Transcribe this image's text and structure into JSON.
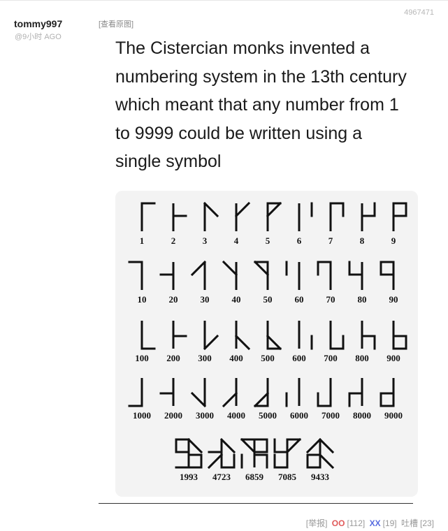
{
  "post": {
    "author": "tommy997",
    "time": "@9小时 AGO",
    "view_original": "[查看原图]",
    "id": "4967471"
  },
  "caption": "The Cistercian monks invented a numbering system in the 13th century which meant that any number from 1 to 9999 could be written using a single symbol",
  "image": {
    "rows": [
      [
        "1",
        "2",
        "3",
        "4",
        "5",
        "6",
        "7",
        "8",
        "9"
      ],
      [
        "10",
        "20",
        "30",
        "40",
        "50",
        "60",
        "70",
        "80",
        "90"
      ],
      [
        "100",
        "200",
        "300",
        "400",
        "500",
        "600",
        "700",
        "800",
        "900"
      ],
      [
        "1000",
        "2000",
        "3000",
        "4000",
        "5000",
        "6000",
        "7000",
        "8000",
        "9000"
      ],
      [
        "1993",
        "4723",
        "6859",
        "7085",
        "9433"
      ]
    ]
  },
  "footer": {
    "report": "[举报]",
    "oo_label": "OO",
    "oo_count": "[112]",
    "xx_label": "XX",
    "xx_count": "[19]",
    "comments_label": "吐槽",
    "comments_count": "[23]"
  }
}
